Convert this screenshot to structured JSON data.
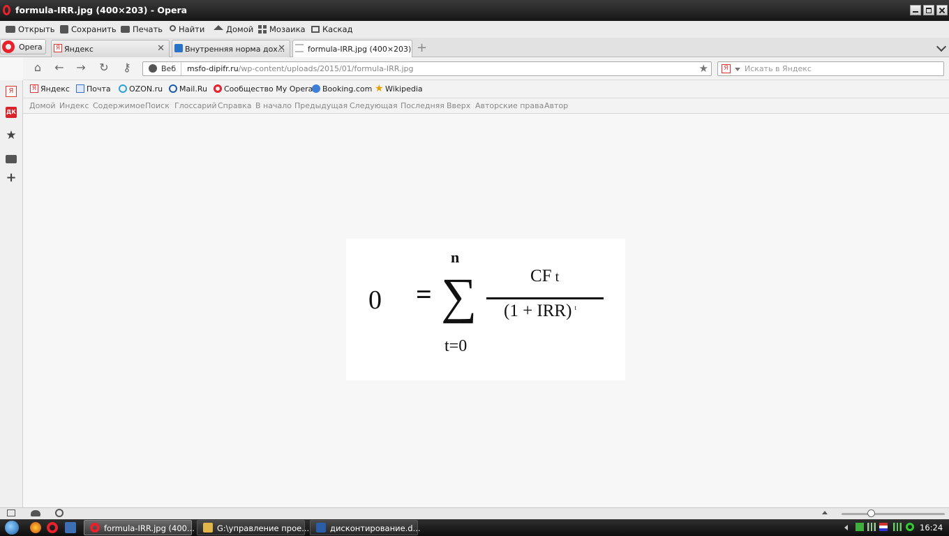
{
  "window": {
    "title": "formula-IRR.jpg (400×203) - Opera"
  },
  "menu": {
    "items": [
      "Открыть",
      "Сохранить",
      "Печать",
      "Найти",
      "Домой",
      "Мозаика",
      "Каскад"
    ]
  },
  "tabs": {
    "opera_button": "Opera",
    "items": [
      {
        "label": "Яндекс"
      },
      {
        "label": "Внутренняя норма дох..."
      },
      {
        "label": "formula-IRR.jpg (400×203)"
      }
    ]
  },
  "address": {
    "web_label": "Веб",
    "url_host": "msfo-dipifr.ru",
    "url_path": "/wp-content/uploads/2015/01/formula-IRR.jpg",
    "search_placeholder": "Искать в Яндекс"
  },
  "bookmarks": [
    "Яндекс",
    "Почта",
    "OZON.ru",
    "Mail.Ru",
    "Сообщество My Opera",
    "Booking.com",
    "Wikipedia"
  ],
  "navlinks": [
    "Домой",
    "Индекс",
    "Содержимое",
    "Поиск",
    "Глоссарий",
    "Справка",
    "В начало",
    "Предыдущая",
    "Следующая",
    "Последняя",
    "Вверх",
    "Авторские права",
    "Автор"
  ],
  "formula": {
    "lhs": "0",
    "equals": "=",
    "sigma": "∑",
    "upper": "n",
    "lower": "t=0",
    "numerator": "CF",
    "numerator_sub": "t",
    "denominator": "(1 + IRR)",
    "denominator_exp": "t"
  },
  "taskbar": {
    "buttons": [
      "formula-IRR.jpg (400...",
      "G:\\управление прое...",
      "дисконтирование.d..."
    ],
    "clock": "16:24"
  }
}
